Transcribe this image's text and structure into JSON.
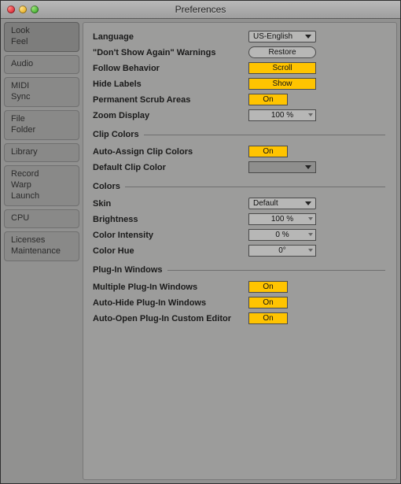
{
  "window": {
    "title": "Preferences"
  },
  "accent": "#ffc400",
  "sidebar": {
    "groups": [
      [
        "Look",
        "Feel"
      ],
      [
        "Audio"
      ],
      [
        "MIDI",
        "Sync"
      ],
      [
        "File",
        "Folder"
      ],
      [
        "Library"
      ],
      [
        "Record",
        "Warp",
        "Launch"
      ],
      [
        "CPU"
      ],
      [
        "Licenses",
        "Maintenance"
      ]
    ],
    "selected_index": 0
  },
  "panel": {
    "language_label": "Language",
    "language_value": "US-English",
    "warnings_label": "\"Don't Show Again\" Warnings",
    "warnings_button": "Restore",
    "follow_label": "Follow Behavior",
    "follow_value": "Scroll",
    "hide_labels_label": "Hide Labels",
    "hide_labels_value": "Show",
    "scrub_label": "Permanent Scrub Areas",
    "scrub_value": "On",
    "zoom_label": "Zoom Display",
    "zoom_value": "100 %",
    "section_clip_colors": "Clip Colors",
    "auto_assign_label": "Auto-Assign Clip Colors",
    "auto_assign_value": "On",
    "default_clip_label": "Default Clip Color",
    "section_colors": "Colors",
    "skin_label": "Skin",
    "skin_value": "Default",
    "brightness_label": "Brightness",
    "brightness_value": "100 %",
    "intensity_label": "Color Intensity",
    "intensity_value": "0 %",
    "hue_label": "Color Hue",
    "hue_value": "0°",
    "section_plugin": "Plug-In Windows",
    "multi_plugin_label": "Multiple Plug-In Windows",
    "multi_plugin_value": "On",
    "auto_hide_label": "Auto-Hide Plug-In Windows",
    "auto_hide_value": "On",
    "auto_open_label": "Auto-Open Plug-In Custom Editor",
    "auto_open_value": "On"
  }
}
